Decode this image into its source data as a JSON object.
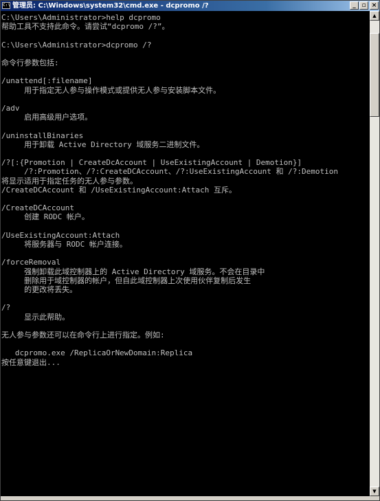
{
  "window": {
    "title": "管理员: C:\\Windows\\system32\\cmd.exe - dcpromo  /?",
    "icon_text": "C:\\",
    "minimize_label": "_",
    "maximize_label": "▫",
    "close_label": "×"
  },
  "console": {
    "lines": [
      "C:\\Users\\Administrator>help dcpromo",
      "帮助工具不支持此命令。请尝试“dcpromo /?”。",
      "",
      "C:\\Users\\Administrator>dcpromo /?",
      "",
      "命令行参数包括:",
      "",
      "/unattend[:filename]",
      "     用于指定无人参与操作模式或提供无人参与安装脚本文件。",
      "",
      "/adv",
      "     启用高级用户选项。",
      "",
      "/uninstallBinaries",
      "     用于卸载 Active Directory 域服务二进制文件。",
      "",
      "/?[:{Promotion | CreateDcAccount | UseExistingAccount | Demotion}]",
      "     /?:Promotion、/?:CreateDCAccount、/?:UseExistingAccount 和 /?:Demotion",
      "将显示适用于指定任务的无人参与参数。",
      "/CreateDCAccount 和 /UseExistingAccount:Attach 互斥。",
      "",
      "/CreateDCAccount",
      "     创建 RODC 帐户。",
      "",
      "/UseExistingAccount:Attach",
      "     将服务器与 RODC 帐户连接。",
      "",
      "/forceRemoval",
      "     强制卸载此域控制器上的 Active Directory 域服务。不会在目录中",
      "     删除用于域控制器的帐户，但自此域控制器上次使用伙伴复制后发生",
      "     的更改将丢失。",
      "",
      "/?",
      "     显示此帮助。",
      "",
      "无人参与参数还可以在命令行上进行指定。例如:",
      "",
      "   dcpromo.exe /ReplicaOrNewDomain:Replica",
      "按任意键退出..."
    ]
  },
  "colors": {
    "console_bg": "#000000",
    "console_fg": "#c0c0c0",
    "titlebar_start": "#0a246a",
    "titlebar_end": "#a6caf0"
  },
  "scrollbar": {
    "up_arrow": "▲",
    "down_arrow": "▼"
  }
}
